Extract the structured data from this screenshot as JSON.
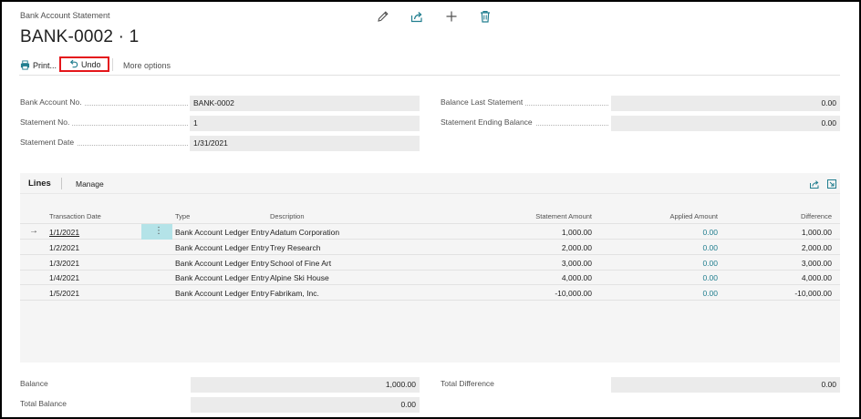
{
  "page": {
    "caption": "Bank Account Statement",
    "title": "BANK-0002 · 1"
  },
  "header_icons": [
    "pencil-icon",
    "share-icon",
    "plus-icon",
    "trash-icon"
  ],
  "actions": {
    "print": "Print...",
    "undo": "Undo",
    "more": "More options"
  },
  "general": {
    "bank_account_no": {
      "label": "Bank Account No.",
      "value": "BANK-0002"
    },
    "statement_no": {
      "label": "Statement No.",
      "value": "1"
    },
    "statement_date": {
      "label": "Statement Date",
      "value": "1/31/2021"
    },
    "balance_last_statement": {
      "label": "Balance Last Statement",
      "value": "0.00"
    },
    "statement_ending_balance": {
      "label": "Statement Ending Balance",
      "value": "0.00"
    }
  },
  "lines": {
    "tab_lines": "Lines",
    "tab_manage": "Manage",
    "columns": {
      "transaction_date": "Transaction Date",
      "type": "Type",
      "description": "Description",
      "statement_amount": "Statement Amount",
      "applied_amount": "Applied Amount",
      "difference": "Difference"
    },
    "rows": [
      {
        "date": "1/1/2021",
        "type": "Bank Account Ledger Entry",
        "description": "Adatum Corporation",
        "statement_amount": "1,000.00",
        "applied_amount": "0.00",
        "difference": "1,000.00"
      },
      {
        "date": "1/2/2021",
        "type": "Bank Account Ledger Entry",
        "description": "Trey Research",
        "statement_amount": "2,000.00",
        "applied_amount": "0.00",
        "difference": "2,000.00"
      },
      {
        "date": "1/3/2021",
        "type": "Bank Account Ledger Entry",
        "description": "School of Fine Art",
        "statement_amount": "3,000.00",
        "applied_amount": "0.00",
        "difference": "3,000.00"
      },
      {
        "date": "1/4/2021",
        "type": "Bank Account Ledger Entry",
        "description": "Alpine Ski House",
        "statement_amount": "4,000.00",
        "applied_amount": "0.00",
        "difference": "4,000.00"
      },
      {
        "date": "1/5/2021",
        "type": "Bank Account Ledger Entry",
        "description": "Fabrikam, Inc.",
        "statement_amount": "-10,000.00",
        "applied_amount": "0.00",
        "difference": "-10,000.00"
      }
    ]
  },
  "totals": {
    "balance": {
      "label": "Balance",
      "value": "1,000.00"
    },
    "total_balance": {
      "label": "Total Balance",
      "value": "0.00"
    },
    "total_difference": {
      "label": "Total Difference",
      "value": "0.00"
    }
  },
  "colors": {
    "accent": "#217e8f",
    "selected_cell": "#b4e3e8",
    "highlight_box": "#e4161b"
  }
}
